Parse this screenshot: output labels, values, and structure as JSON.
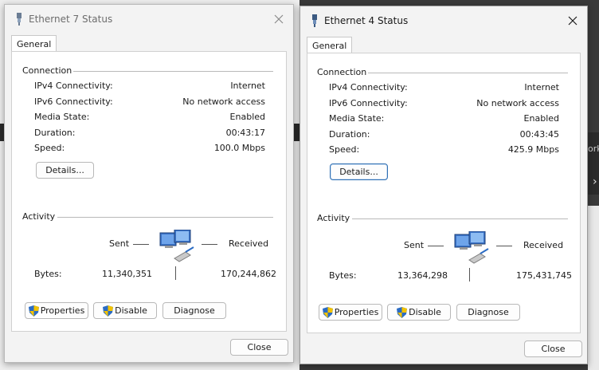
{
  "background": {
    "right_fragment_text": "ork",
    "right_fragment_arrow": "›"
  },
  "windows": [
    {
      "title": "Ethernet 7 Status",
      "tab": "General",
      "connection_title": "Connection",
      "rows": [
        {
          "label": "IPv4 Connectivity:",
          "value": "Internet"
        },
        {
          "label": "IPv6 Connectivity:",
          "value": "No network access"
        },
        {
          "label": "Media State:",
          "value": "Enabled"
        },
        {
          "label": "Duration:",
          "value": "00:43:17"
        },
        {
          "label": "Speed:",
          "value": "100.0 Mbps"
        }
      ],
      "details_label": "Details...",
      "activity_title": "Activity",
      "sent_label": "Sent",
      "received_label": "Received",
      "bytes_label": "Bytes:",
      "bytes_sent": "11,340,351",
      "bytes_received": "170,244,862",
      "properties_label": "Properties",
      "disable_label": "Disable",
      "diagnose_label": "Diagnose",
      "close_label": "Close"
    },
    {
      "title": "Ethernet 4 Status",
      "tab": "General",
      "connection_title": "Connection",
      "rows": [
        {
          "label": "IPv4 Connectivity:",
          "value": "Internet"
        },
        {
          "label": "IPv6 Connectivity:",
          "value": "No network access"
        },
        {
          "label": "Media State:",
          "value": "Enabled"
        },
        {
          "label": "Duration:",
          "value": "00:43:45"
        },
        {
          "label": "Speed:",
          "value": "425.9 Mbps"
        }
      ],
      "details_label": "Details...",
      "activity_title": "Activity",
      "sent_label": "Sent",
      "received_label": "Received",
      "bytes_label": "Bytes:",
      "bytes_sent": "13,364,298",
      "bytes_received": "175,431,745",
      "properties_label": "Properties",
      "disable_label": "Disable",
      "diagnose_label": "Diagnose",
      "close_label": "Close"
    }
  ],
  "icons": [
    "network-adapter-icon",
    "close-icon",
    "shield-icon",
    "network-computers-icon"
  ],
  "colors": {
    "focus_border": "#2f6fb3",
    "shield_blue": "#2b6cc4",
    "shield_yellow": "#f2c200"
  }
}
